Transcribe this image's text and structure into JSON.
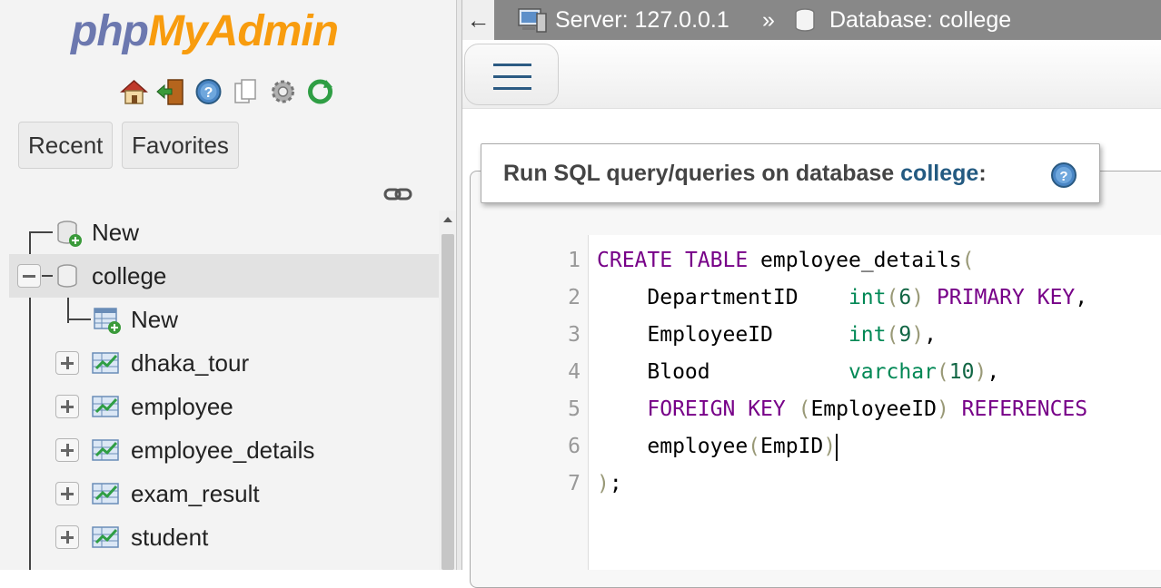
{
  "nav": {
    "logo": {
      "part1": "php",
      "part2": "MyAdmin"
    },
    "icons": [
      "home-icon",
      "logout-icon",
      "help-icon",
      "docs-icon",
      "settings-icon",
      "reload-icon"
    ],
    "tabs": {
      "recent": "Recent",
      "favorites": "Favorites"
    },
    "tree": {
      "new_root": "New",
      "database": "college",
      "new_table": "New",
      "tables": [
        "dhaka_tour",
        "employee",
        "employee_details",
        "exam_result",
        "student"
      ]
    }
  },
  "topbar": {
    "back": "←",
    "server": "Server: 127.0.0.1",
    "separator": "»",
    "database": "Database: college"
  },
  "query_panel": {
    "title_prefix": "Run SQL query/queries on database ",
    "db_name": "college",
    "title_suffix": ":"
  },
  "editor": {
    "line_numbers": [
      "1",
      "2",
      "3",
      "4",
      "5",
      "6",
      "7"
    ],
    "lines": [
      [
        {
          "t": "kw",
          "v": "CREATE"
        },
        {
          "t": "",
          "v": " "
        },
        {
          "t": "kw",
          "v": "TABLE"
        },
        {
          "t": "",
          "v": " employee_details"
        },
        {
          "t": "br",
          "v": "("
        }
      ],
      [
        {
          "t": "",
          "v": "    DepartmentID    "
        },
        {
          "t": "ty",
          "v": "int"
        },
        {
          "t": "br",
          "v": "("
        },
        {
          "t": "nm",
          "v": "6"
        },
        {
          "t": "br",
          "v": ")"
        },
        {
          "t": "",
          "v": " "
        },
        {
          "t": "kw",
          "v": "PRIMARY"
        },
        {
          "t": "",
          "v": " "
        },
        {
          "t": "kw",
          "v": "KEY"
        },
        {
          "t": "",
          "v": ","
        }
      ],
      [
        {
          "t": "",
          "v": "    EmployeeID      "
        },
        {
          "t": "ty",
          "v": "int"
        },
        {
          "t": "br",
          "v": "("
        },
        {
          "t": "nm",
          "v": "9"
        },
        {
          "t": "br",
          "v": ")"
        },
        {
          "t": "",
          "v": ","
        }
      ],
      [
        {
          "t": "",
          "v": "    Blood           "
        },
        {
          "t": "ty",
          "v": "varchar"
        },
        {
          "t": "br",
          "v": "("
        },
        {
          "t": "nm",
          "v": "10"
        },
        {
          "t": "br",
          "v": ")"
        },
        {
          "t": "",
          "v": ","
        }
      ],
      [
        {
          "t": "",
          "v": "    "
        },
        {
          "t": "kw",
          "v": "FOREIGN"
        },
        {
          "t": "",
          "v": " "
        },
        {
          "t": "kw",
          "v": "KEY"
        },
        {
          "t": "",
          "v": " "
        },
        {
          "t": "br",
          "v": "("
        },
        {
          "t": "",
          "v": "EmployeeID"
        },
        {
          "t": "br",
          "v": ")"
        },
        {
          "t": "",
          "v": " "
        },
        {
          "t": "kw",
          "v": "REFERENCES"
        }
      ],
      [
        {
          "t": "",
          "v": "    employee"
        },
        {
          "t": "br",
          "v": "("
        },
        {
          "t": "",
          "v": "EmpID"
        },
        {
          "t": "br",
          "v": ")"
        }
      ],
      [
        {
          "t": "br",
          "v": ")"
        },
        {
          "t": "",
          "v": ";"
        }
      ]
    ]
  },
  "colors": {
    "keyword": "#770088",
    "type": "#008855",
    "number": "#116644",
    "bracket": "#999977",
    "link": "#235a81",
    "topbar": "#888888"
  }
}
